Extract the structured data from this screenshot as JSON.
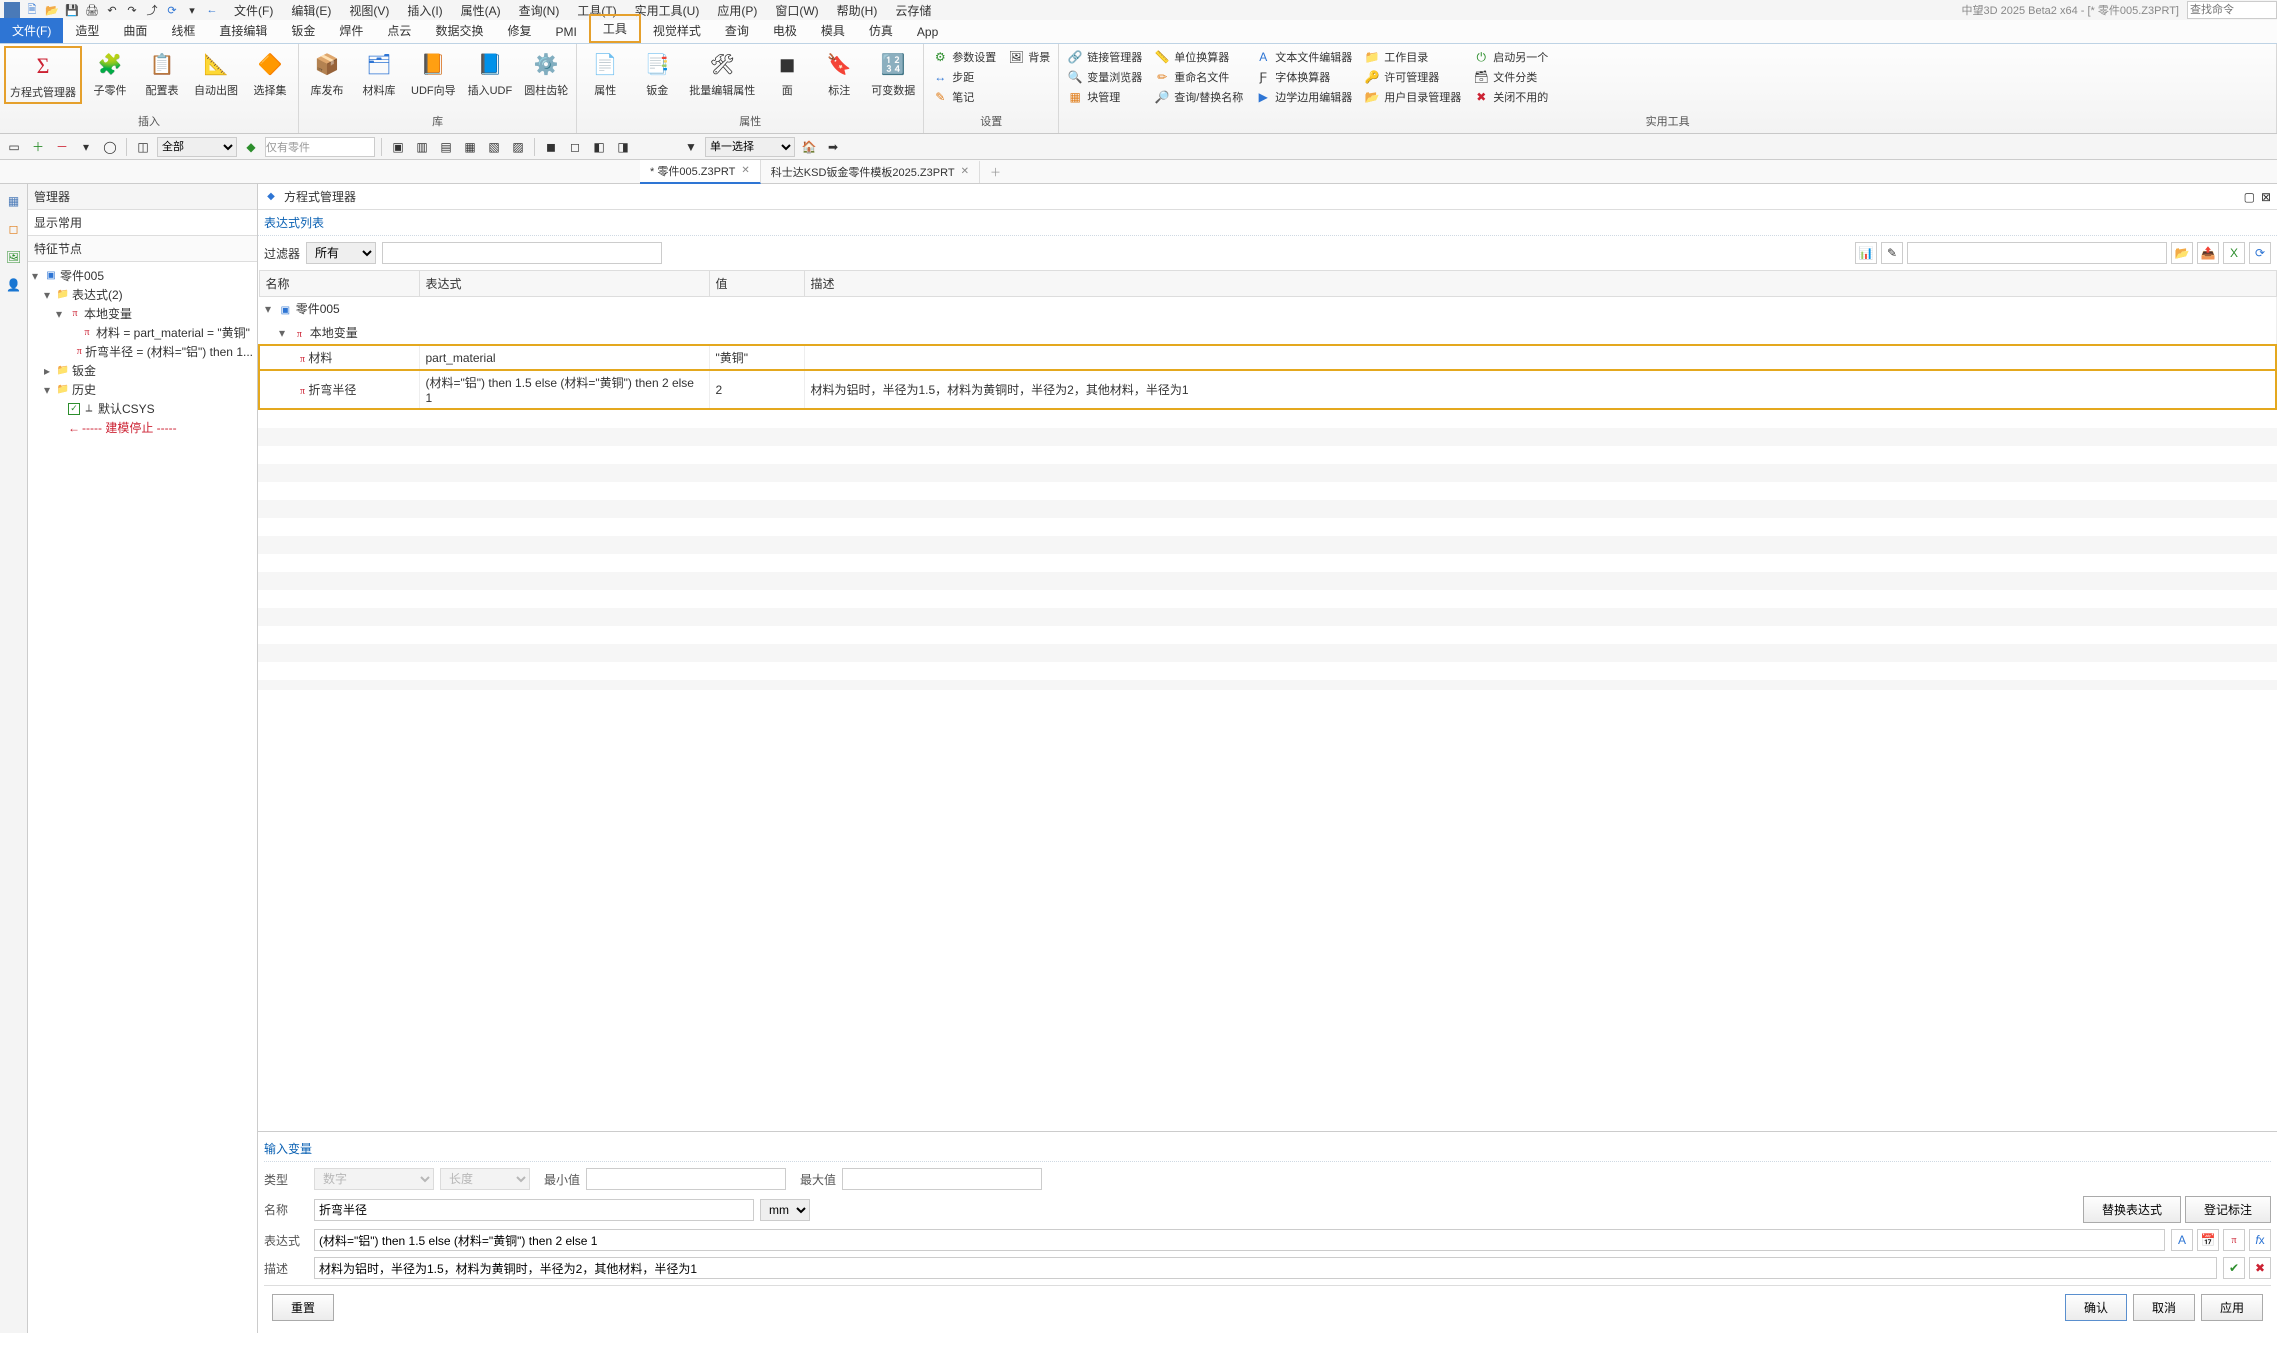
{
  "title": "中望3D 2025 Beta2 x64 - [* 零件005.Z3PRT]",
  "search_placeholder": "查找命令",
  "menus": [
    "文件(F)",
    "编辑(E)",
    "视图(V)",
    "插入(I)",
    "属性(A)",
    "查询(N)",
    "工具(T)",
    "实用工具(U)",
    "应用(P)",
    "窗口(W)",
    "帮助(H)",
    "云存储"
  ],
  "ribbon_tabs": [
    "文件(F)",
    "造型",
    "曲面",
    "线框",
    "直接编辑",
    "钣金",
    "焊件",
    "点云",
    "数据交换",
    "修复",
    "PMI",
    "工具",
    "视觉样式",
    "查询",
    "电极",
    "模具",
    "仿真",
    "App"
  ],
  "ribbon_active": "文件(F)",
  "ribbon_highlighted": "工具",
  "ribbon": {
    "g_insert": {
      "items": [
        "方程式管理器",
        "子零件",
        "配置表",
        "自动出图",
        "选择集"
      ],
      "label": "插入",
      "highlighted": "方程式管理器"
    },
    "g_lib": {
      "items": [
        "库发布",
        "材料库",
        "UDF向导",
        "插入UDF",
        "圆柱齿轮"
      ],
      "label": "库"
    },
    "g_attr": {
      "items": [
        "属性",
        "钣金",
        "批量编辑属性",
        "面",
        "标注",
        "可变数据"
      ],
      "label": "属性"
    },
    "g_settings": {
      "small": [
        "参数设置",
        "背景",
        "步距",
        "笔记"
      ],
      "label": "设置"
    },
    "g_utils": {
      "small": [
        "链接管理器",
        "单位换算器",
        "文本文件编辑器",
        "工作目录",
        "启动另一个",
        "变量浏览器",
        "重命名文件",
        "字体换算器",
        "许可管理器",
        "文件分类",
        "块管理",
        "查询/替换名称",
        "边学边用编辑器",
        "用户目录管理器",
        "关闭不用的"
      ],
      "label": "实用工具"
    }
  },
  "toolbar2": {
    "scope": "全部",
    "only_parts": "仅有零件",
    "mode": "单一选择"
  },
  "doc_tabs": [
    "* 零件005.Z3PRT",
    "科士达KSD钣金零件模板2025.Z3PRT"
  ],
  "left_panel": {
    "title": "管理器",
    "display": "显示常用",
    "section": "特征节点",
    "tree": {
      "root": "零件005",
      "expr": "表达式(2)",
      "localvar": "本地变量",
      "var1": "材料 = part_material = \"黄铜\"",
      "var2": "折弯半径 = (材料=\"铝\") then 1...",
      "sheetmetal": "钣金",
      "history": "历史",
      "csys": "默认CSYS",
      "stop": "----- 建模停止 -----"
    }
  },
  "eqn_panel": {
    "title": "方程式管理器",
    "section": "表达式列表",
    "filter_label": "过滤器",
    "filter_val": "所有",
    "columns": [
      "名称",
      "表达式",
      "值",
      "描述"
    ],
    "group_root": "零件005",
    "group_local": "本地变量",
    "rows": [
      {
        "name": "材料",
        "expr": "part_material",
        "val": "\"黄铜\"",
        "desc": ""
      },
      {
        "name": "折弯半径",
        "expr": "(材料=\"铝\") then 1.5 else (材料=\"黄铜\") then 2 else 1",
        "val": "2",
        "desc": "材料为铝时，半径为1.5，材料为黄铜时，半径为2，其他材料，半径为1"
      }
    ]
  },
  "input_section": {
    "title": "输入变量",
    "type_label": "类型",
    "type_val": "数字",
    "len_label": "长度",
    "min_label": "最小值",
    "max_label": "最大值",
    "name_label": "名称",
    "name_val": "折弯半径",
    "unit": "mm",
    "replace_btn": "替换表达式",
    "annotate_btn": "登记标注",
    "expr_label": "表达式",
    "expr_val": "(材料=\"铝\") then 1.5 else (材料=\"黄铜\") then 2 else 1",
    "desc_label": "描述",
    "desc_val": "材料为铝时，半径为1.5，材料为黄铜时，半径为2，其他材料，半径为1",
    "reset": "重置",
    "ok": "确认",
    "cancel": "取消",
    "apply": "应用"
  }
}
